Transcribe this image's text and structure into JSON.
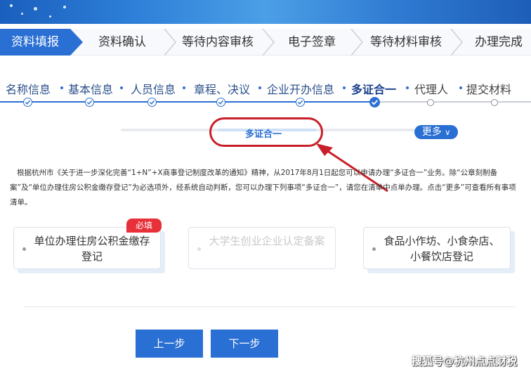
{
  "main_steps": [
    {
      "label": "资料填报",
      "active": true
    },
    {
      "label": "资料确认",
      "active": false
    },
    {
      "label": "等待内容审核",
      "active": false
    },
    {
      "label": "电子签章",
      "active": false
    },
    {
      "label": "等待材料审核",
      "active": false
    },
    {
      "label": "办理完成",
      "active": false
    }
  ],
  "sub_steps": [
    {
      "label": "名称信息",
      "status": "done"
    },
    {
      "label": "基本信息",
      "status": "done"
    },
    {
      "label": "人员信息",
      "status": "done"
    },
    {
      "label": "章程、决议",
      "status": "done"
    },
    {
      "label": "企业开办信息",
      "status": "done"
    },
    {
      "label": "多证合一",
      "status": "current"
    },
    {
      "label": "代理人",
      "status": "todo"
    },
    {
      "label": "提交材料",
      "status": "todo"
    }
  ],
  "tab": {
    "label": "多证合一",
    "more_label": "更多"
  },
  "notice": "根据杭州市《关于进一步深化完善“1+N”+X商事登记制度改革的通知》精神，从2017年8月1日起您可以申请办理“多证合一”业务。除“公章刻制备案”及“单位办理住房公积金缴存登记”为必选项外，经系统自动判断，您可以办理下列事项“多证合一”，请您在清单中点单办理。点击“更多”可查看所有事项清单。",
  "items": [
    {
      "label": "单位办理住房公积金缴存登记",
      "badge": "必填",
      "enabled": true
    },
    {
      "label": "大学生创业企业认定备案",
      "enabled": false
    },
    {
      "label": "食品小作坊、小食杂店、小餐饮店登记",
      "enabled": true
    }
  ],
  "buttons": {
    "prev": "上一步",
    "next": "下一步"
  },
  "watermark": "搜狐号@杭州点点财税",
  "colors": {
    "primary": "#2a6fd3",
    "annotation": "#c8202a",
    "badge": "#e8303a"
  }
}
